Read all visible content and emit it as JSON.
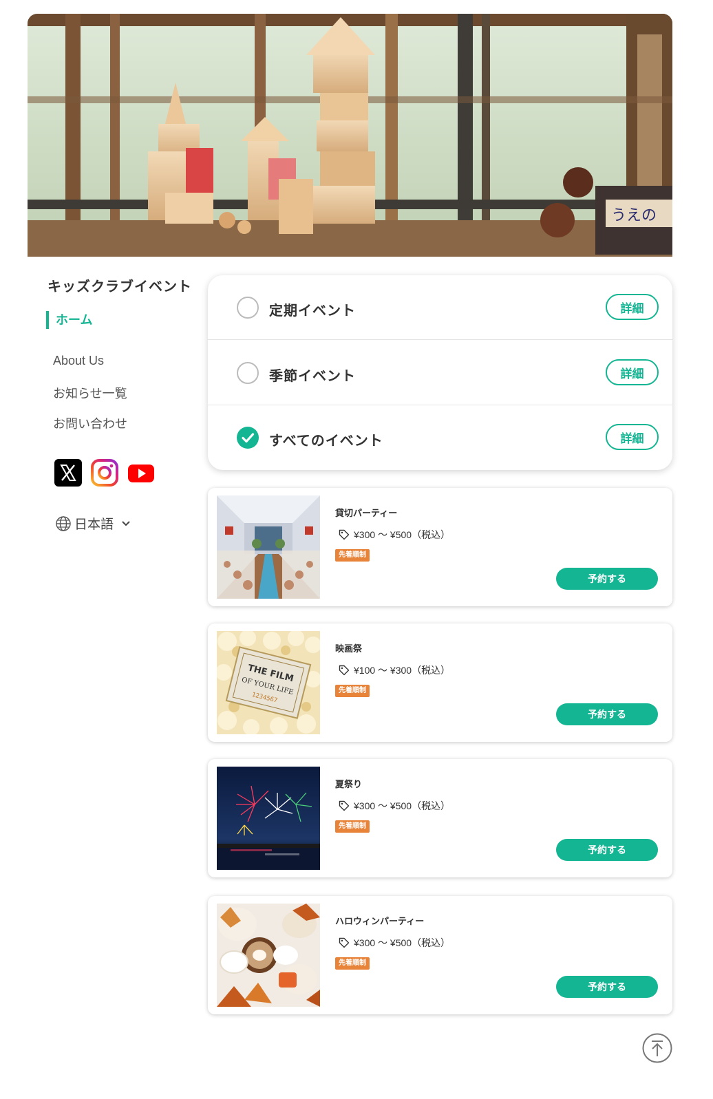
{
  "site": {
    "title": "キッズクラブイベント"
  },
  "nav": {
    "home": "ホーム",
    "links": [
      "About Us",
      "お知らせ一覧",
      "お問い合わせ"
    ]
  },
  "social": {
    "icons": [
      "x-icon",
      "instagram-icon",
      "youtube-icon"
    ]
  },
  "language": {
    "label": "日本語"
  },
  "filters": [
    {
      "label": "定期イベント",
      "checked": false,
      "detail": "詳細"
    },
    {
      "label": "季節イベント",
      "checked": false,
      "detail": "詳細"
    },
    {
      "label": "すべてのイベント",
      "checked": true,
      "detail": "詳細"
    }
  ],
  "events": [
    {
      "title": "貸切パーティー",
      "price": "¥300 〜 ¥500（税込）",
      "badge": "先着順制",
      "button": "予約する",
      "image": "banquet-hall"
    },
    {
      "title": "映画祭",
      "price": "¥100 〜 ¥300（税込）",
      "badge": "先着順制",
      "button": "予約する",
      "image": "film-ticket-popcorn",
      "image_text": {
        "line1": "THE FILM",
        "line2": "OF YOUR LIFE",
        "line3": "1234567"
      }
    },
    {
      "title": "夏祭り",
      "price": "¥300 〜 ¥500（税込）",
      "badge": "先着順制",
      "button": "予約する",
      "image": "fireworks"
    },
    {
      "title": "ハロウィンパーティー",
      "price": "¥300 〜 ¥500（税込）",
      "badge": "先着順制",
      "button": "予約する",
      "image": "pumpkins-autumn"
    }
  ],
  "hero": {
    "sign_text": "うえの"
  },
  "colors": {
    "accent": "#14b593",
    "badge": "#e8833a",
    "text": "#333333"
  }
}
